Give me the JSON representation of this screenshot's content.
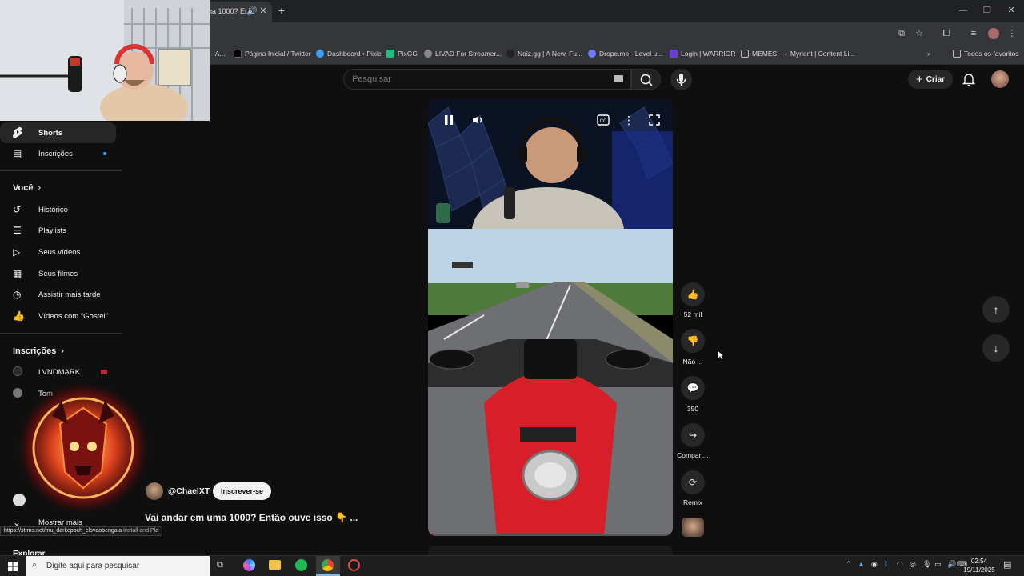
{
  "browser": {
    "active_tab_title": "na 1000? Er",
    "new_tab_label": "+",
    "window_controls": {
      "minimize": "—",
      "restore": "❐",
      "close": "✕"
    },
    "bookmarks": [
      {
        "label": "- A...",
        "color": "#555555"
      },
      {
        "label": "Página Inicial / Twitter",
        "color": "#000000"
      },
      {
        "label": "Dashboard • Pixie",
        "color": "#3aa0ff"
      },
      {
        "label": "PixGG",
        "color": "#19c27e"
      },
      {
        "label": "LIVAD For Streamer...",
        "color": "#888888"
      },
      {
        "label": "Noiz.gg | A New, Fu...",
        "color": "#222222"
      },
      {
        "label": "Drope.me - Level u...",
        "color": "#6a7bff"
      },
      {
        "label": "Login | WARRIOR",
        "color": "#6b3fd6"
      },
      {
        "label": "MEMES",
        "color": "#aaaaaa"
      },
      {
        "label": "Myrient | Content Li...",
        "color": "#444444"
      }
    ],
    "all_bookmarks_label": "Todos os favoritos"
  },
  "header": {
    "search_placeholder": "Pesquisar",
    "create_label": "Criar"
  },
  "sidebar": {
    "top_items": [
      {
        "label": "Shorts",
        "icon": "shorts-icon",
        "active": true
      },
      {
        "label": "Inscrições",
        "icon": "subscriptions-icon",
        "dot": true
      }
    ],
    "you_heading": "Você",
    "you_items": [
      {
        "label": "Histórico",
        "icon": "history-icon"
      },
      {
        "label": "Playlists",
        "icon": "playlists-icon"
      },
      {
        "label": "Seus vídeos",
        "icon": "your-videos-icon"
      },
      {
        "label": "Seus filmes",
        "icon": "movies-icon"
      },
      {
        "label": "Assistir mais tarde",
        "icon": "watch-later-icon"
      },
      {
        "label": "Vídeos com \"Gostei\"",
        "icon": "liked-icon"
      }
    ],
    "subs_heading": "Inscrições",
    "subs_items": [
      {
        "label": "LVNDMARK"
      },
      {
        "label": "Tom"
      }
    ],
    "show_more_label": "Mostrar mais",
    "explore_heading": "Explorar"
  },
  "short": {
    "channel": "@ChaelXT",
    "subscribe_label": "Inscrever-se",
    "title": "Vai andar em uma 1000? Então ouve isso 👇 ...",
    "progress": 0.02,
    "rail": [
      {
        "icon": "like-icon",
        "glyph": "👍",
        "label": "52 mil"
      },
      {
        "icon": "dislike-icon",
        "glyph": "👎",
        "label": "Não ..."
      },
      {
        "icon": "comment-icon",
        "glyph": "💬",
        "label": "350"
      },
      {
        "icon": "share-icon",
        "glyph": "↪",
        "label": "Compart..."
      },
      {
        "icon": "remix-icon",
        "glyph": "⟳",
        "label": "Remix"
      }
    ]
  },
  "status_url": "https://strms.net/mu_darkepoch_clovaobengala",
  "status_suffix": "Install and Pla",
  "taskbar": {
    "search_placeholder": "Digite aqui para pesquisar",
    "time": "02:54",
    "date": "19/11/2025"
  }
}
